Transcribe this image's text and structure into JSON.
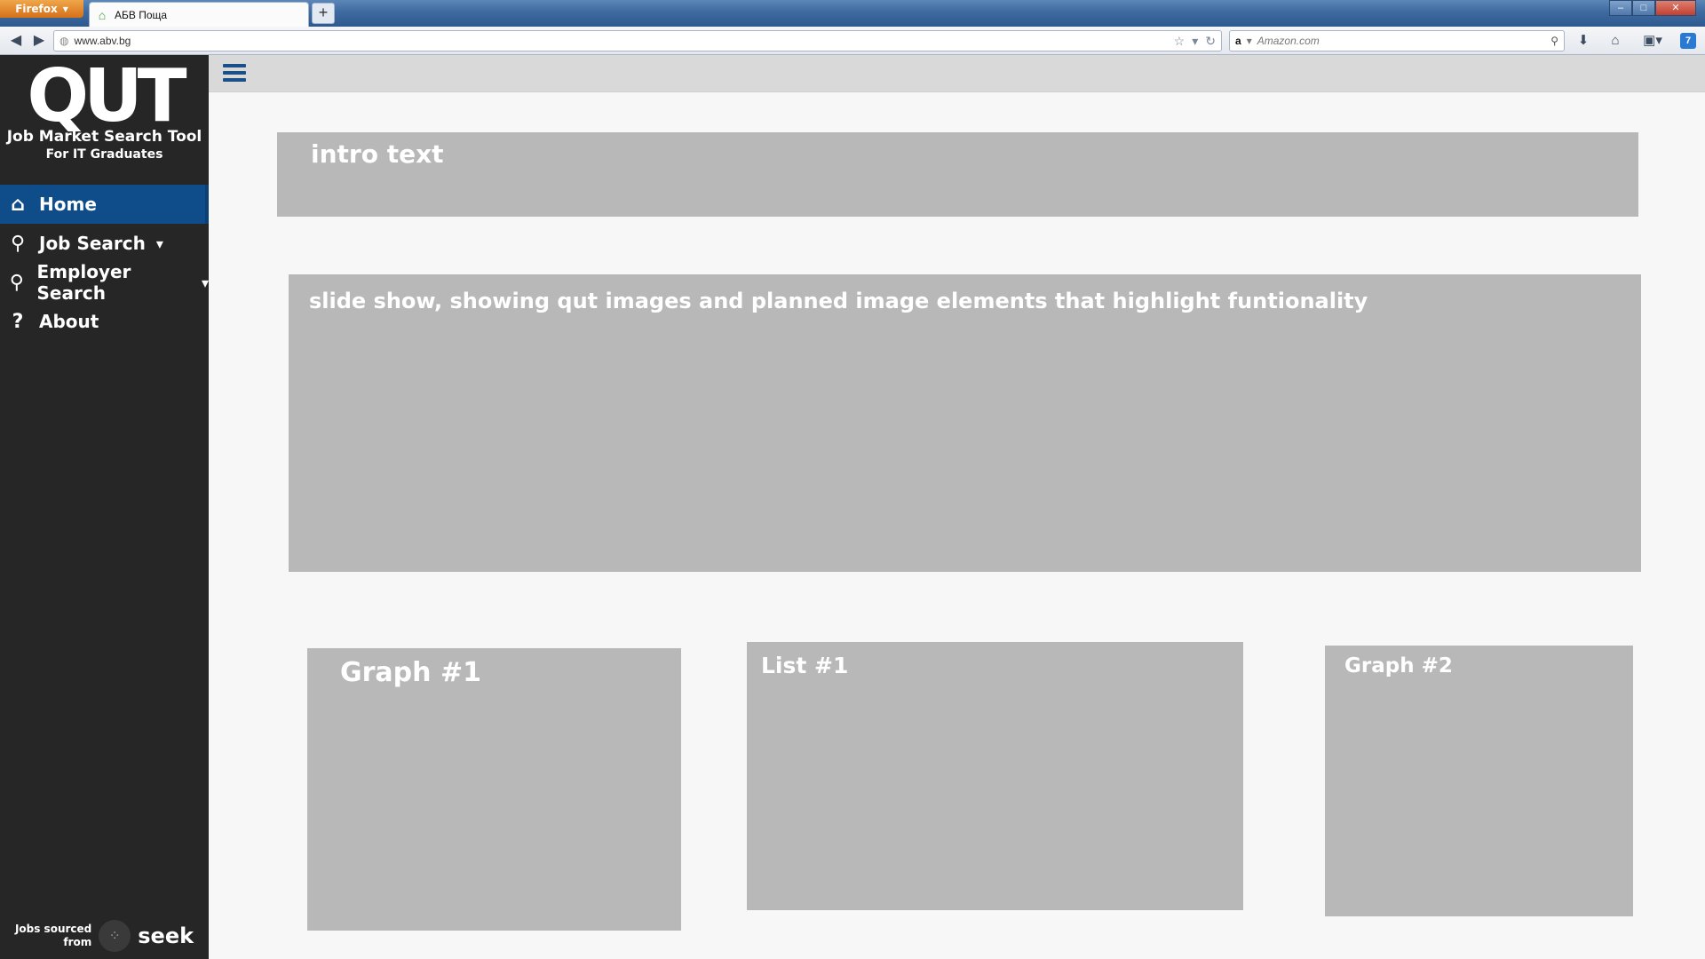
{
  "browser": {
    "menu_button": "Firefox",
    "tab_title": "АБВ Поща",
    "new_tab": "+",
    "url": "www.abv.bg",
    "search_engine_glyph": "a",
    "search_placeholder": "Amazon.com",
    "badge_count": "7"
  },
  "sidebar": {
    "logo": "QUT",
    "title": "Job Market Search Tool",
    "subtitle": "For IT Graduates",
    "nav": [
      {
        "label": "Home",
        "icon": "home-icon",
        "active": true
      },
      {
        "label": "Job Search",
        "icon": "search-icon",
        "caret": "▾"
      },
      {
        "label": "Employer Search",
        "icon": "search-icon",
        "caret": "▾"
      },
      {
        "label": "About",
        "icon": "question-icon"
      }
    ],
    "source_line1": "Jobs sourced",
    "source_line2": "from",
    "source_brand": "seek"
  },
  "main": {
    "intro": "intro text",
    "slideshow": "slide show, showing qut images and planned image elements that highlight funtionality",
    "graph1": "Graph #1",
    "list1": "List #1",
    "graph2": "Graph #2"
  },
  "colors": {
    "sidebar_bg": "#262626",
    "active_nav": "#0f4c8a",
    "placeholder_box": "#b8b8b8",
    "hamburger": "#1a4f8a"
  }
}
